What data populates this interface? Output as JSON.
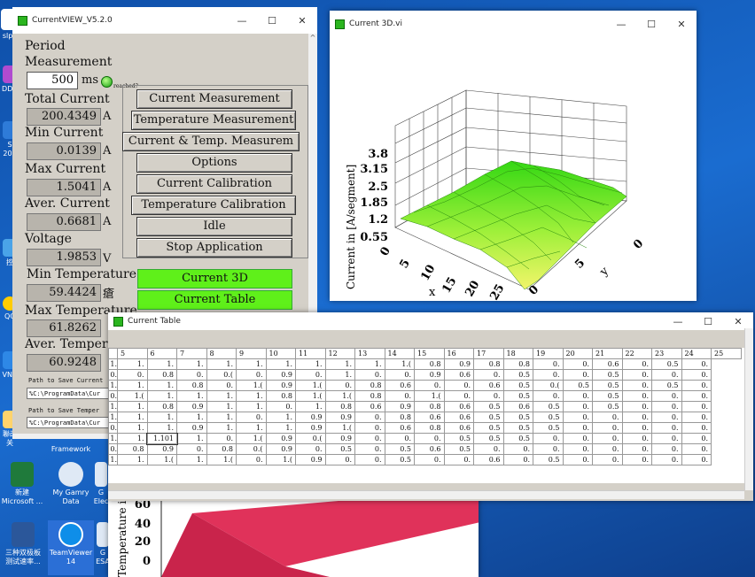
{
  "desktop": {
    "icons": [
      {
        "label": "slpo"
      },
      {
        "label": "DDC"
      },
      {
        "label": "S\n202"
      },
      {
        "label": "控"
      },
      {
        "label": "QC"
      },
      {
        "label": "VNC"
      },
      {
        "label": "聯改\n关"
      },
      {
        "label": "Framework"
      },
      {
        "label": "新建\nMicrosoft ..."
      },
      {
        "label": "My Gamry\nData"
      },
      {
        "label": "G\nElec"
      },
      {
        "label": "三种双极板\n测试速率..."
      },
      {
        "label": "TeamViewer\n14"
      },
      {
        "label": "G\nESA"
      }
    ]
  },
  "cv_window": {
    "title": "CurrentVIEW_V5.2.0",
    "period_label": "Period",
    "measurement_label": "Measurement",
    "period_value": "500",
    "period_unit": "ms",
    "reached_label": "reached?",
    "total_current_label": "Total Current",
    "total_current_value": "200.4349",
    "total_current_unit": "A",
    "min_current_label": "Min Current",
    "min_current_value": "0.0139",
    "min_current_unit": "A",
    "max_current_label": "Max Current",
    "max_current_value": "1.5041",
    "max_current_unit": "A",
    "aver_current_label": "Aver. Current",
    "aver_current_value": "0.6681",
    "aver_current_unit": "A",
    "voltage_label": "Voltage",
    "voltage_value": "1.9853",
    "voltage_unit": "V",
    "min_temp_label": "Min Temperature",
    "min_temp_value": "59.4424",
    "min_temp_unit": "瘡",
    "max_temp_label": "Max Temperature",
    "max_temp_value": "61.8262",
    "aver_temp_label": "Aver. Temper",
    "aver_temp_value": "60.9248",
    "path_current_label": "Path to Save Current",
    "path_current_value": "%C:\\ProgramData\\Cur",
    "path_temp_label": "Path to Save Temper",
    "path_temp_value": "%C:\\ProgramData\\Cur",
    "buttons": [
      "Current Measurement",
      "Temperature Measurement",
      "Current & Temp. Measurem",
      "Options",
      "Current Calibration",
      "Temperature Calibration",
      "Idle",
      "Stop Application"
    ],
    "green_buttons": [
      "Current 3D",
      "Current Table"
    ]
  },
  "c3d_window": {
    "title": "Current 3D.vi",
    "zlabel": "Current in [A/segment]",
    "zticks": [
      "3.8",
      "3.15",
      "2.5",
      "1.85",
      "1.2",
      "0.55"
    ],
    "xlabel": "x",
    "xticks": [
      "0",
      "5",
      "10",
      "15",
      "20",
      "25"
    ],
    "ylabel": "y",
    "yticks": [
      "0",
      "5"
    ]
  },
  "temp3d": {
    "zlabel": "Temperature i",
    "zticks": [
      "60",
      "40",
      "20",
      "0"
    ]
  },
  "table_window": {
    "title": "Current Table",
    "edit_cell": "1.101",
    "headers": [
      "5",
      "6",
      "7",
      "8",
      "9",
      "10",
      "11",
      "12",
      "13",
      "14",
      "15",
      "16",
      "17",
      "18",
      "19",
      "20",
      "21",
      "22",
      "23",
      "24",
      "25"
    ],
    "rows": [
      [
        "1.",
        "1.",
        "1.",
        "1.",
        "1.",
        "1.",
        "1.",
        "1.",
        "1.",
        "1.(",
        "0.8",
        "0.9",
        "0.8",
        "0.8",
        "0.",
        "0.",
        "0.6",
        "0.",
        "0.5",
        "0."
      ],
      [
        "0.",
        "0.8",
        "0.",
        "0.(",
        "0.",
        "0.9",
        "0.",
        "1.",
        "0.",
        "0.",
        "0.9",
        "0.6",
        "0.",
        "0.5",
        "0.",
        "0.",
        "0.5",
        "0.",
        "0.",
        "0."
      ],
      [
        "1.",
        "1.",
        "0.8",
        "0.",
        "1.(",
        "0.9",
        "1.(",
        "0.",
        "0.8",
        "0.6",
        "0.",
        "0.",
        "0.6",
        "0.5",
        "0.(",
        "0.5",
        "0.5",
        "0.",
        "0.5",
        "0."
      ],
      [
        "1.(",
        "1.",
        "1.",
        "1.",
        "1.",
        "0.8",
        "1.(",
        "1.(",
        "0.8",
        "0.",
        "1.(",
        "0.",
        "0.",
        "0.5",
        "0.",
        "0.",
        "0.5",
        "0.",
        "0.",
        "0."
      ],
      [
        "1.",
        "0.8",
        "0.9",
        "1.",
        "1.",
        "0.",
        "1.",
        "0.8",
        "0.6",
        "0.9",
        "0.8",
        "0.6",
        "0.5",
        "0.6",
        "0.5",
        "0.",
        "0.5",
        "0.",
        "0.",
        "0."
      ],
      [
        "1.",
        "1.",
        "1.",
        "1.",
        "0.",
        "1.",
        "0.9",
        "0.9",
        "0.",
        "0.8",
        "0.6",
        "0.6",
        "0.5",
        "0.5",
        "0.5",
        "0.",
        "0.",
        "0.",
        "0.",
        "0."
      ],
      [
        "1.",
        "1.",
        "0.9",
        "1.",
        "1.",
        "1.",
        "0.9",
        "1.(",
        "0.",
        "0.6",
        "0.8",
        "0.6",
        "0.5",
        "0.5",
        "0.5",
        "0.",
        "0.",
        "0.",
        "0.",
        "0."
      ],
      [
        "1.",
        "1.101",
        "1.",
        "0.",
        "1.(",
        "0.9",
        "0.(",
        "0.9",
        "0.",
        "0.",
        "0.",
        "0.5",
        "0.5",
        "0.5",
        "0.",
        "0.",
        "0.",
        "0.",
        "0.",
        "0."
      ],
      [
        "0.8",
        "0.9",
        "0.",
        "0.8",
        "0.(",
        "0.9",
        "0.",
        "0.5",
        "0.",
        "0.5",
        "0.6",
        "0.5",
        "0.",
        "0.",
        "0.",
        "0.",
        "0.",
        "0.",
        "0.",
        "0."
      ],
      [
        "1.",
        "1.(",
        "1.",
        "1.(",
        "0.",
        "1.(",
        "0.9",
        "0.",
        "0.",
        "0.5",
        "0.",
        "0.",
        "0.6",
        "0.",
        "0.5",
        "0.",
        "0.",
        "0.",
        "0.",
        "0."
      ]
    ],
    "row_prefix": [
      "1.",
      "0.",
      "1.",
      "0.",
      "1.",
      "1.",
      "0.",
      "1.",
      "0.",
      "1.",
      "1."
    ]
  }
}
